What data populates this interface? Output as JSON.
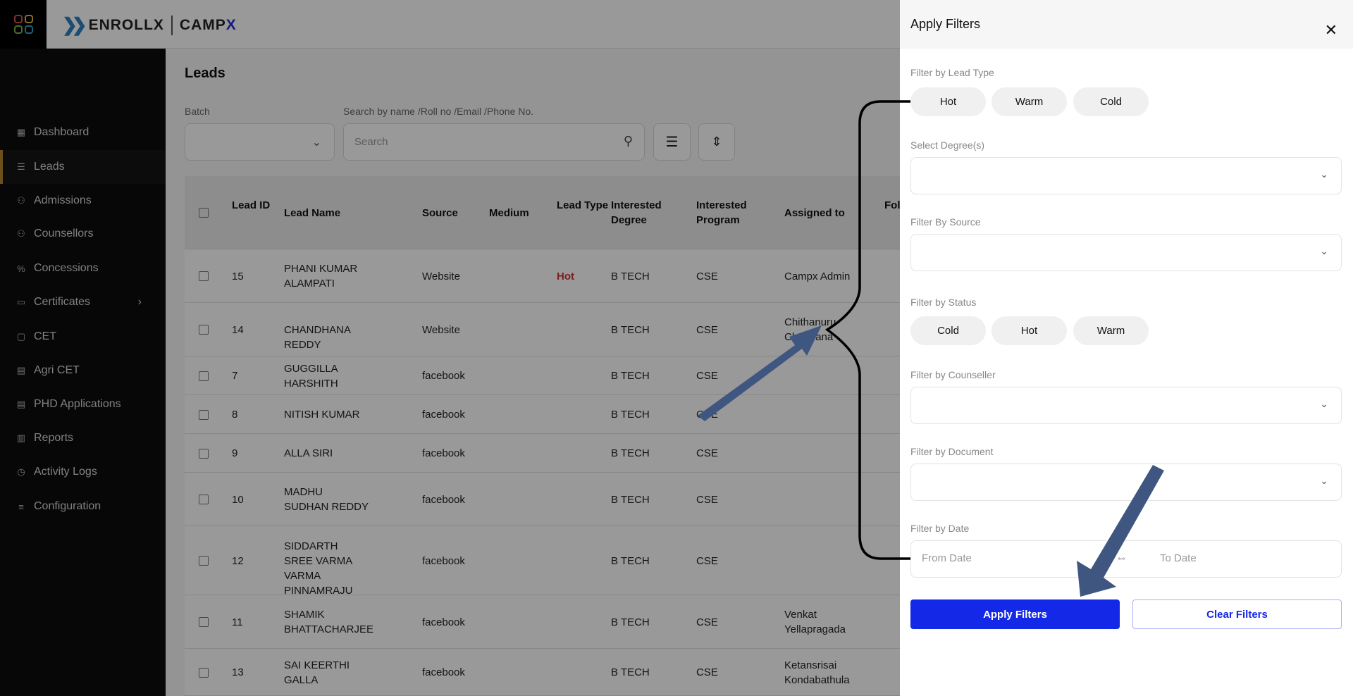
{
  "brand": {
    "left": "ENROLLX",
    "right_main": "CAMP",
    "right_accent": "X"
  },
  "sidebar": {
    "items": [
      {
        "label": "Dashboard",
        "icon": "grid-icon"
      },
      {
        "label": "Leads",
        "icon": "checklist-icon",
        "active": true
      },
      {
        "label": "Admissions",
        "icon": "users-icon"
      },
      {
        "label": "Counsellors",
        "icon": "users-icon"
      },
      {
        "label": "Concessions",
        "icon": "percent-icon"
      },
      {
        "label": "Certificates",
        "icon": "certificate-icon",
        "has_submenu": true
      },
      {
        "label": "CET",
        "icon": "square-icon"
      },
      {
        "label": "Agri CET",
        "icon": "document-icon"
      },
      {
        "label": "PHD Applications",
        "icon": "document-icon"
      },
      {
        "label": "Reports",
        "icon": "bar-chart-icon"
      },
      {
        "label": "Activity Logs",
        "icon": "clock-icon"
      },
      {
        "label": "Configuration",
        "icon": "sliders-icon"
      }
    ]
  },
  "page": {
    "title": "Leads",
    "batch_label": "Batch",
    "search_label": "Search by name /Roll no /Email /Phone No.",
    "search_placeholder": "Search"
  },
  "table": {
    "headers": [
      "Lead ID",
      "Lead Name",
      "Source",
      "Medium",
      "Lead Type",
      "Interested Degree",
      "Interested Program",
      "Assigned to",
      "Fol da"
    ],
    "rows": [
      [
        "15",
        "PHANI KUMAR ALAMPATI",
        "Website",
        "",
        "Hot",
        "B TECH",
        "CSE",
        "Campx Admin"
      ],
      [
        "14",
        "CHANDHANA REDDY",
        "Website",
        "",
        "",
        "B TECH",
        "CSE",
        "Chithanuru Chandana"
      ],
      [
        "7",
        "GUGGILLA HARSHITH",
        "facebook",
        "",
        "",
        "B TECH",
        "CSE",
        ""
      ],
      [
        "8",
        "NITISH KUMAR",
        "facebook",
        "",
        "",
        "B TECH",
        "CSE",
        ""
      ],
      [
        "9",
        "ALLA SIRI",
        "facebook",
        "",
        "",
        "B TECH",
        "CSE",
        ""
      ],
      [
        "10",
        "MADHU SUDHAN REDDY",
        "facebook",
        "",
        "",
        "B TECH",
        "CSE",
        ""
      ],
      [
        "12",
        "SIDDARTH SREE VARMA VARMA PINNAMRAJU",
        "facebook",
        "",
        "",
        "B TECH",
        "CSE",
        ""
      ],
      [
        "11",
        "SHAMIK BHATTACHARJEE",
        "facebook",
        "",
        "",
        "B TECH",
        "CSE",
        "Venkat Yellapragada"
      ],
      [
        "13",
        "SAI KEERTHI GALLA",
        "facebook",
        "",
        "",
        "B TECH",
        "CSE",
        "Ketansrisai Kondabathula"
      ]
    ]
  },
  "panel": {
    "title": "Apply Filters",
    "lead_type_label": "Filter by Lead Type",
    "lead_types": [
      "Hot",
      "Warm",
      "Cold"
    ],
    "degree_label": "Select Degree(s)",
    "source_label": "Filter By Source",
    "status_label": "Filter by Status",
    "statuses": [
      "Cold",
      "Hot",
      "Warm"
    ],
    "counseller_label": "Filter by Counseller",
    "document_label": "Filter by Document",
    "date_label": "Filter by Date",
    "from_placeholder": "From Date",
    "to_placeholder": "To Date",
    "apply": "Apply Filters",
    "clear": "Clear Filters"
  },
  "colors": {
    "primary": "#1428e8",
    "hot": "#d32f2f",
    "sidebar_active": "#b8862e",
    "annotation_arrow": "#3f5680"
  }
}
